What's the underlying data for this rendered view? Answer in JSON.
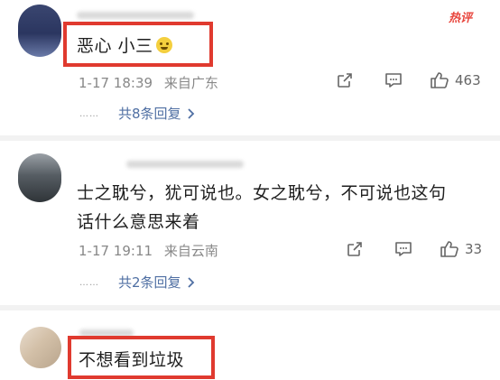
{
  "hot_label": "热评",
  "comments": [
    {
      "text": "恶心 小三",
      "time": "1-17 18:39",
      "location": "来自广东",
      "likes": "463",
      "replies_label": "共8条回复",
      "replies_dots": "……"
    },
    {
      "text_line1": "士之耽兮，犹可说也。女之耽兮，不可说也这句",
      "text_line2": "话什么意思来着",
      "time": "1-17 19:11",
      "location": "来自云南",
      "likes": "33",
      "replies_label": "共2条回复",
      "replies_dots": "……"
    },
    {
      "text": "不想看到垃圾"
    }
  ],
  "icons": {
    "share": "share-icon",
    "comment": "comment-icon",
    "like": "like-icon",
    "chevron": "chevron-right-icon",
    "emoji": "smiling-emoji-icon"
  },
  "colors": {
    "highlight_box": "#e03a2f",
    "reply_link": "#4f6fa3",
    "hot_label": "#e8453c"
  }
}
